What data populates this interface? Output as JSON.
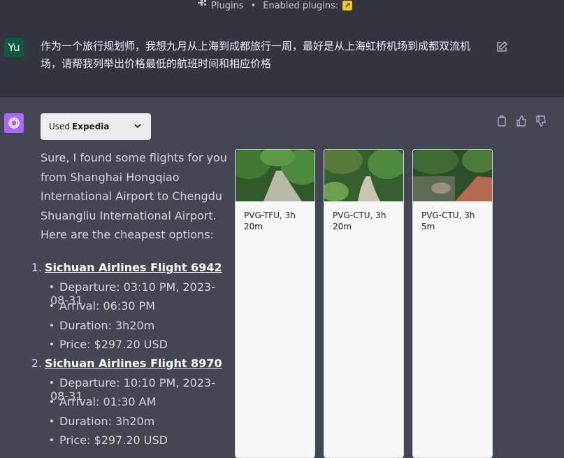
{
  "header": {
    "plugins_label": "Plugins",
    "enabled_label": "Enabled plugins:"
  },
  "user_message": {
    "avatar_text": "Yu",
    "text": "作为一个旅行规划师，我想九月从上海到成都旅行一周，最好是从上海虹桥机场到成都双流机场，请帮我列举出价格最低的航班时间和相应价格"
  },
  "assistant": {
    "used_prefix": "Used",
    "used_plugin": "Expedia",
    "intro": "Sure, I found some flights for you from Shanghai Hongqiao International Airport to Chengdu Shuangliu International Airport. Here are the cheapest options:",
    "flights": [
      {
        "num": "1.",
        "name": "Sichuan Airlines Flight 6942",
        "details": [
          "Departure: 03:10 PM, 2023-08-31",
          "Arrival: 06:30 PM",
          "Duration: 3h20m",
          "Price: $297.20 USD"
        ]
      },
      {
        "num": "2.",
        "name": "Sichuan Airlines Flight 8970",
        "details": [
          "Departure: 10:10 PM, 2023-08-31",
          "Arrival: 01:30 AM",
          "Duration: 3h20m",
          "Price: $297.20 USD"
        ]
      }
    ],
    "cards": [
      {
        "caption": "PVG-TFU, 3h 20m"
      },
      {
        "caption": "PVG-CTU, 3h 20m"
      },
      {
        "caption": "PVG-CTU, 3h 5m"
      }
    ]
  },
  "colors": {
    "page_bg": "#444654",
    "user_bg": "#343541",
    "user_avatar": "#0e5a3f",
    "assistant_avatar": "#ab68ff",
    "plugin_badge": "#f5c518"
  }
}
